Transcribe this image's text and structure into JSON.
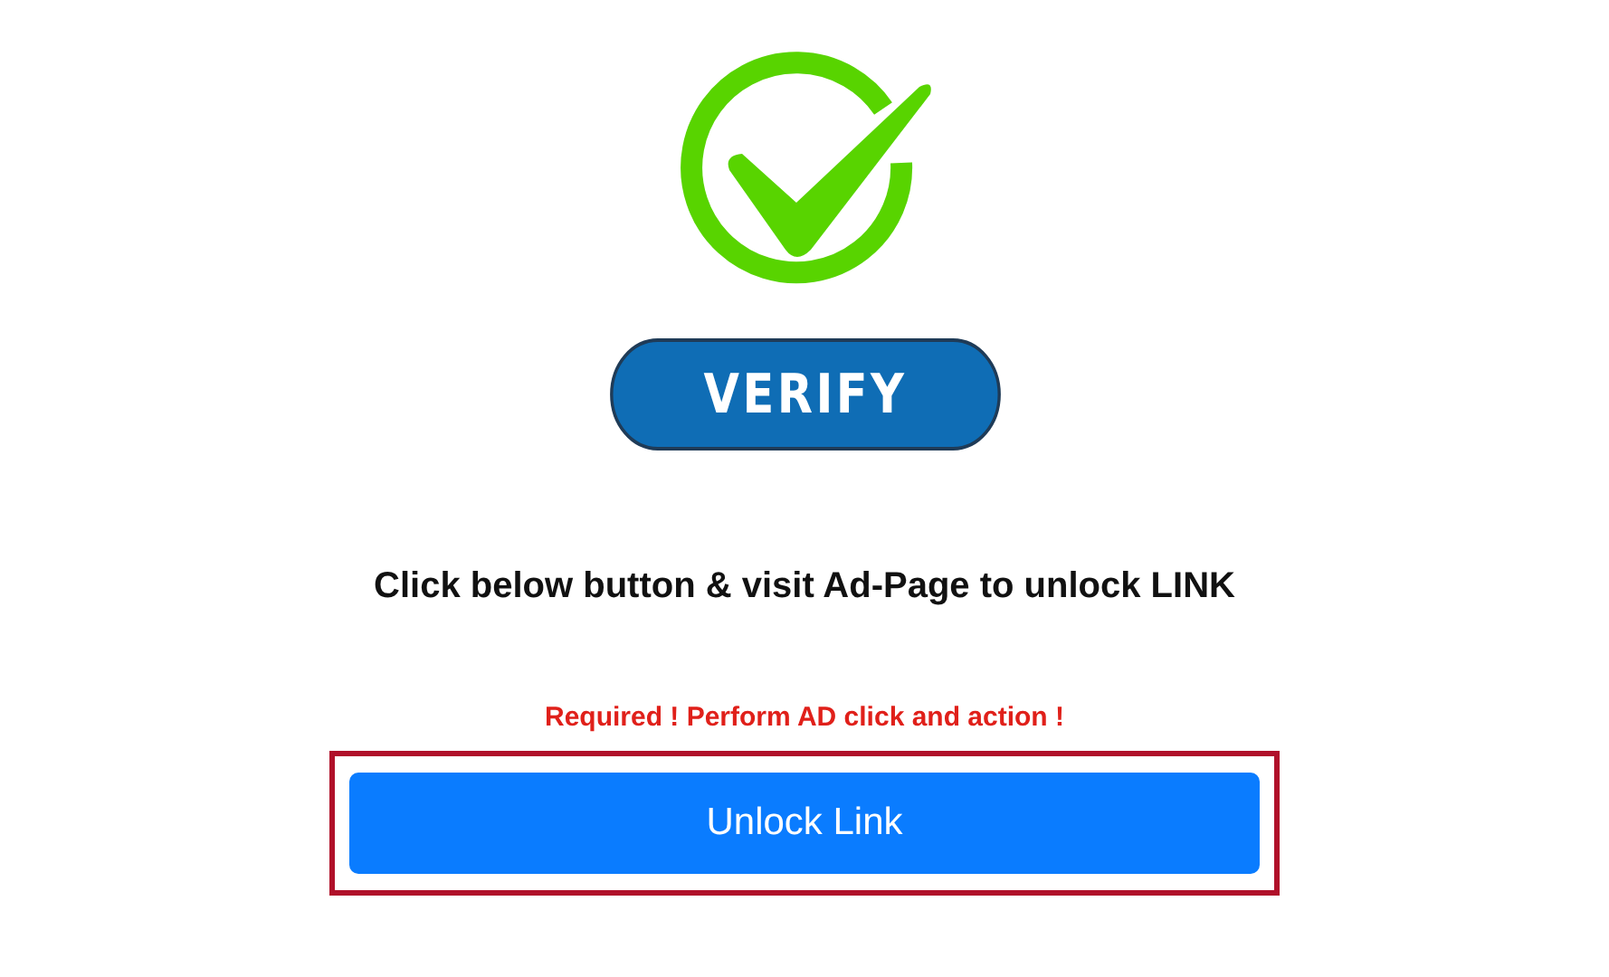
{
  "verify_badge": {
    "label": "VERIFY"
  },
  "instruction": "Click below button & visit Ad-Page to unlock LINK",
  "warning": "Required ! Perform AD click and action !",
  "unlock_button": {
    "label": "Unlock Link",
    "highlighted": true
  }
}
